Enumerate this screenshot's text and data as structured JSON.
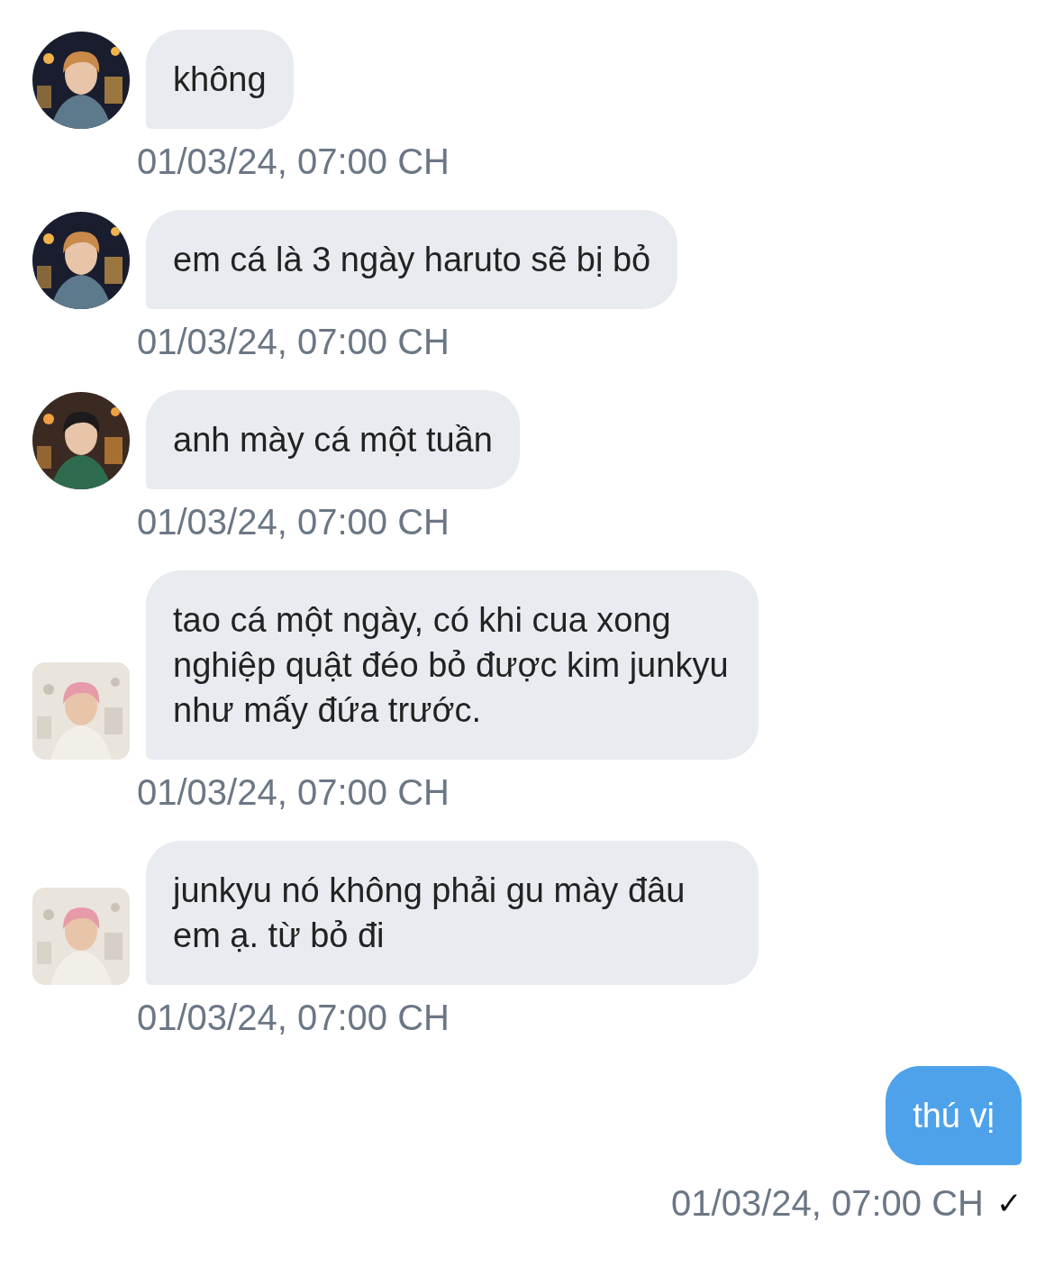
{
  "messages": [
    {
      "kind": "incoming",
      "avatar": {
        "kind": "picture",
        "square": false
      },
      "text": "không",
      "time": "01/03/24, 07:00 CH"
    },
    {
      "kind": "incoming",
      "avatar": {
        "kind": "picture",
        "square": false
      },
      "text": "em cá là 3 ngày haruto sẽ bị bỏ",
      "time": "01/03/24, 07:00 CH"
    },
    {
      "kind": "incoming",
      "avatar": {
        "kind": "picture",
        "square": false
      },
      "text": "anh mày cá một tuần",
      "time": "01/03/24, 07:00 CH"
    },
    {
      "kind": "incoming",
      "avatar": {
        "kind": "picture",
        "square": true
      },
      "text": "tao cá một ngày, có khi cua xong nghiệp quật đéo bỏ được kim junkyu như mấy đứa trước.",
      "time": "01/03/24, 07:00 CH"
    },
    {
      "kind": "incoming",
      "avatar": {
        "kind": "picture",
        "square": true
      },
      "text": "junkyu nó không phải gu mày đâu em ạ. từ bỏ đi",
      "time": "01/03/24, 07:00 CH"
    },
    {
      "kind": "outgoing",
      "text": "thú vị",
      "time": "01/03/24, 07:00 CH",
      "status": "✓"
    }
  ]
}
